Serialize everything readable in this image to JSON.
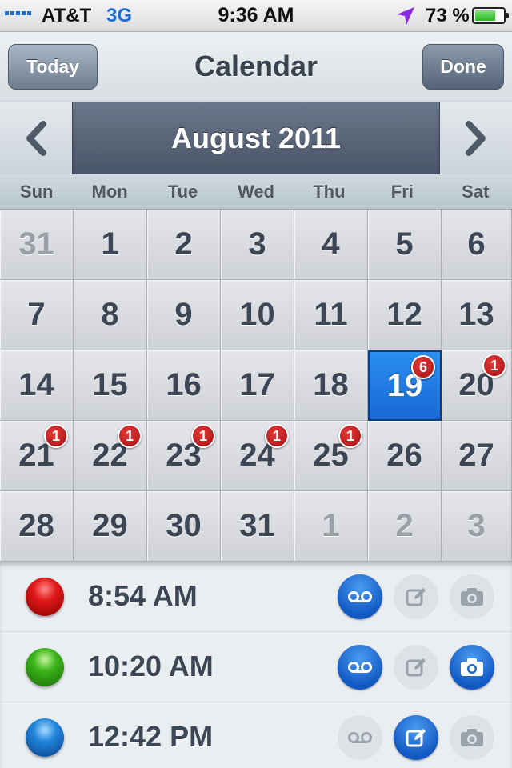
{
  "status_bar": {
    "carrier": "AT&T",
    "network": "3G",
    "time": "9:36 AM",
    "battery_percent": "73 %",
    "battery_level": 0.73
  },
  "nav": {
    "title": "Calendar",
    "left_button": "Today",
    "right_button": "Done"
  },
  "month": {
    "title": "August 2011"
  },
  "weekdays": [
    "Sun",
    "Mon",
    "Tue",
    "Wed",
    "Thu",
    "Fri",
    "Sat"
  ],
  "days": [
    {
      "d": "31",
      "other": true
    },
    {
      "d": "1"
    },
    {
      "d": "2"
    },
    {
      "d": "3"
    },
    {
      "d": "4"
    },
    {
      "d": "5"
    },
    {
      "d": "6"
    },
    {
      "d": "7"
    },
    {
      "d": "8"
    },
    {
      "d": "9"
    },
    {
      "d": "10"
    },
    {
      "d": "11"
    },
    {
      "d": "12"
    },
    {
      "d": "13"
    },
    {
      "d": "14"
    },
    {
      "d": "15"
    },
    {
      "d": "16"
    },
    {
      "d": "17"
    },
    {
      "d": "18"
    },
    {
      "d": "19",
      "selected": true,
      "badge": "6"
    },
    {
      "d": "20",
      "badge": "1"
    },
    {
      "d": "21",
      "badge": "1"
    },
    {
      "d": "22",
      "badge": "1"
    },
    {
      "d": "23",
      "badge": "1"
    },
    {
      "d": "24",
      "badge": "1"
    },
    {
      "d": "25",
      "badge": "1"
    },
    {
      "d": "26"
    },
    {
      "d": "27"
    },
    {
      "d": "28"
    },
    {
      "d": "29"
    },
    {
      "d": "30"
    },
    {
      "d": "31"
    },
    {
      "d": "1",
      "other": true
    },
    {
      "d": "2",
      "other": true
    },
    {
      "d": "3",
      "other": true
    }
  ],
  "events": [
    {
      "time": "8:54 AM",
      "dot": "red",
      "voicemail": true,
      "note": false,
      "camera": false
    },
    {
      "time": "10:20 AM",
      "dot": "green",
      "voicemail": true,
      "note": false,
      "camera": true
    },
    {
      "time": "12:42 PM",
      "dot": "blue",
      "voicemail": false,
      "note": true,
      "camera": false
    }
  ],
  "colors": {
    "accent_blue": "#1768d6",
    "badge_red": "#a60f12",
    "header_dark": "#4a5468",
    "text_dark": "#3c4654"
  }
}
